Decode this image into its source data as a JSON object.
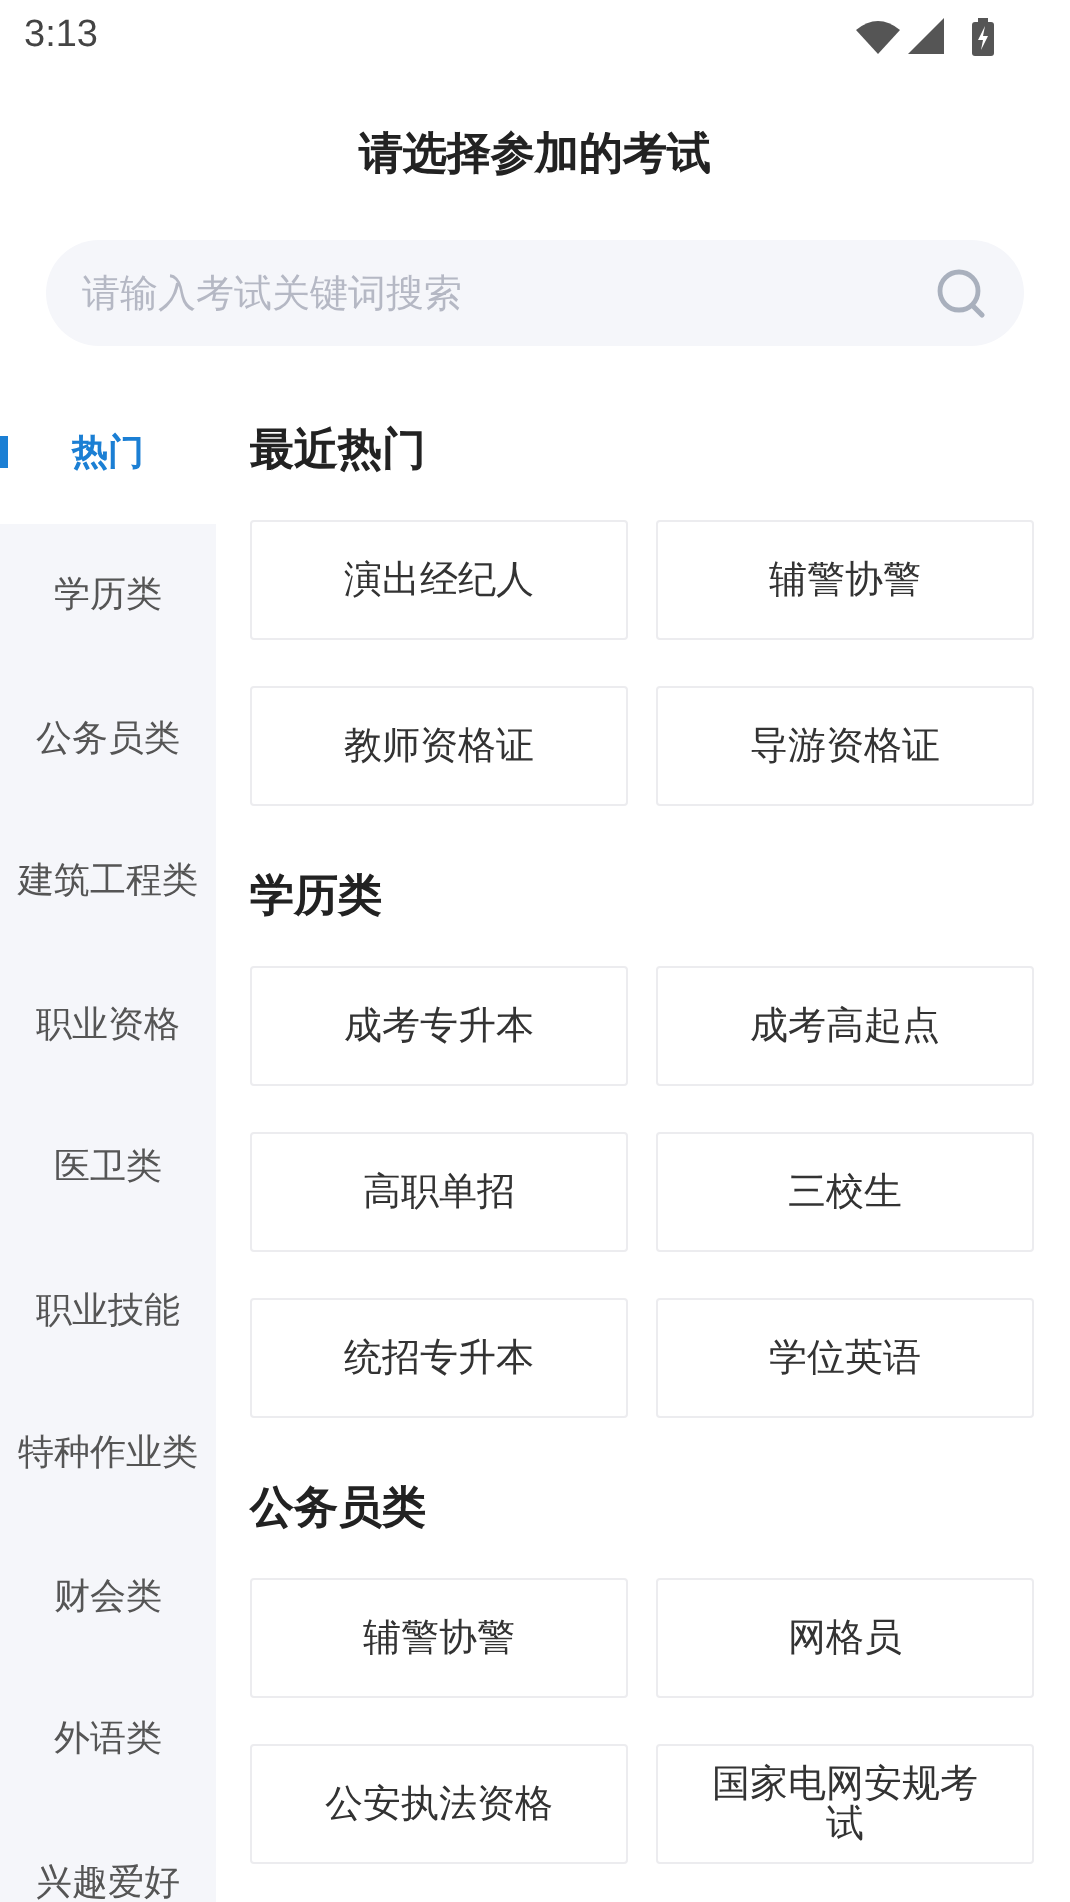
{
  "status_bar": {
    "time": "3:13"
  },
  "title": "请选择参加的考试",
  "search": {
    "placeholder": "请输入考试关键词搜索"
  },
  "sidebar": {
    "items": [
      {
        "label": "热门",
        "selected": true
      },
      {
        "label": "学历类",
        "selected": false
      },
      {
        "label": "公务员类",
        "selected": false
      },
      {
        "label": "建筑工程类",
        "selected": false
      },
      {
        "label": "职业资格",
        "selected": false
      },
      {
        "label": "医卫类",
        "selected": false
      },
      {
        "label": "职业技能",
        "selected": false
      },
      {
        "label": "特种作业类",
        "selected": false
      },
      {
        "label": "财会类",
        "selected": false
      },
      {
        "label": "外语类",
        "selected": false
      },
      {
        "label": "兴趣爱好",
        "selected": false
      }
    ]
  },
  "sections": [
    {
      "title": "最近热门",
      "items": [
        "演出经纪人",
        "辅警协警",
        "教师资格证",
        "导游资格证"
      ]
    },
    {
      "title": "学历类",
      "items": [
        "成考专升本",
        "成考高起点",
        "高职单招",
        "三校生",
        "统招专升本",
        "学位英语"
      ]
    },
    {
      "title": "公务员类",
      "items": [
        "辅警协警",
        "网格员",
        "公安执法资格",
        "国家电网安规考试"
      ]
    }
  ]
}
